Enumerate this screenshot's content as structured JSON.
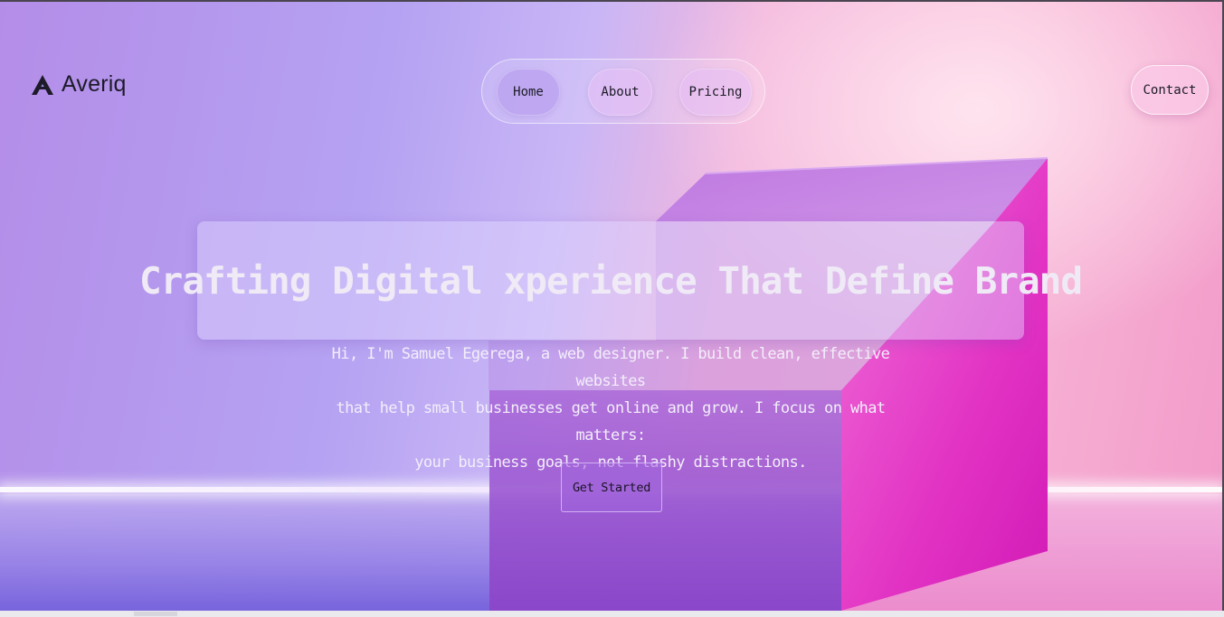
{
  "brand": {
    "name": "Averiq",
    "icon": "logo-a-icon"
  },
  "nav": {
    "items": [
      {
        "label": "Home"
      },
      {
        "label": "About"
      },
      {
        "label": "Pricing"
      }
    ],
    "contact_label": "Contact"
  },
  "hero": {
    "title": "Crafting Digital xperience That Define Brand",
    "subtitle_lines": [
      "Hi, I'm Samuel Egerega, a web designer. I build clean, effective websites",
      "that help small businesses get online and grow. I focus on what matters:",
      "your business goals, not flashy distractions."
    ],
    "cta_label": "Get Started"
  },
  "colors": {
    "background_left": "#b48de8",
    "background_right": "#f29ac9",
    "box_purple": "#a35fd8",
    "box_magenta": "#e12fc6",
    "text_dark": "#1b1b26"
  }
}
